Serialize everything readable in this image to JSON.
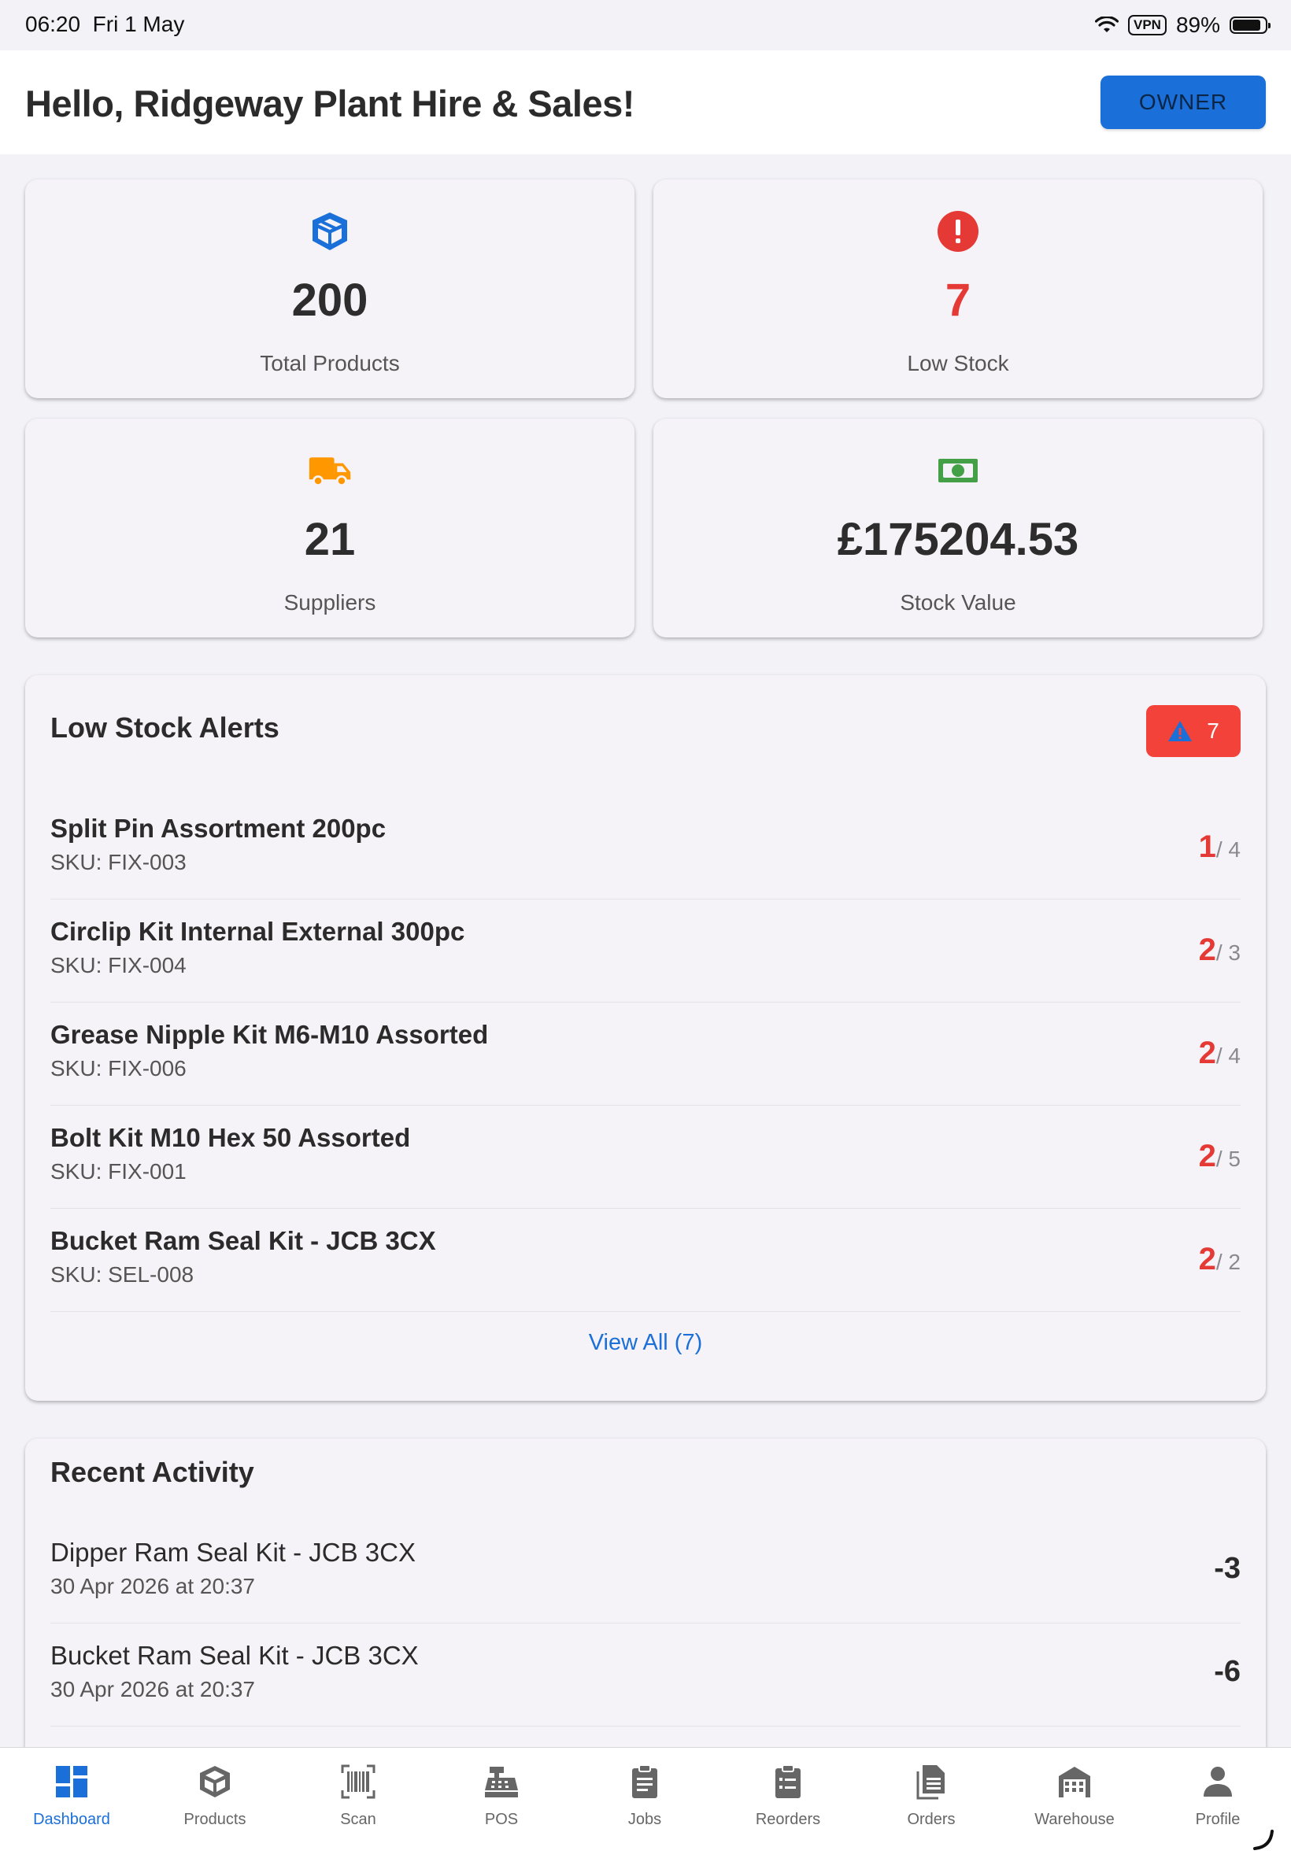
{
  "status_bar": {
    "time": "06:20",
    "date": "Fri 1 May",
    "vpn": "VPN",
    "battery": "89%",
    "battery_level": 0.89
  },
  "header": {
    "greeting": "Hello, Ridgeway Plant Hire & Sales!",
    "role": "OWNER"
  },
  "stats": [
    {
      "icon": "cube-icon",
      "value": "200",
      "label": "Total Products",
      "value_color": "#2d2d2d",
      "icon_color": "#1b6fd8"
    },
    {
      "icon": "alert-circle-icon",
      "value": "7",
      "label": "Low Stock",
      "value_color": "#e53935",
      "icon_color": "#e53935"
    },
    {
      "icon": "truck-icon",
      "value": "21",
      "label": "Suppliers",
      "value_color": "#2d2d2d",
      "icon_color": "#ff9800"
    },
    {
      "icon": "cash-icon",
      "value": "£175204.53",
      "label": "Stock Value",
      "value_color": "#2d2d2d",
      "icon_color": "#43a047"
    }
  ],
  "low_stock": {
    "title": "Low Stock Alerts",
    "badge_count": "7",
    "items": [
      {
        "name": "Split Pin Assortment 200pc",
        "sku": "SKU: FIX-003",
        "current": "1",
        "min": "/ 4"
      },
      {
        "name": "Circlip Kit Internal External 300pc",
        "sku": "SKU: FIX-004",
        "current": "2",
        "min": "/ 3"
      },
      {
        "name": "Grease Nipple Kit M6-M10 Assorted",
        "sku": "SKU: FIX-006",
        "current": "2",
        "min": "/ 4"
      },
      {
        "name": "Bolt Kit M10 Hex 50 Assorted",
        "sku": "SKU: FIX-001",
        "current": "2",
        "min": "/ 5"
      },
      {
        "name": "Bucket Ram Seal Kit - JCB 3CX",
        "sku": "SKU: SEL-008",
        "current": "2",
        "min": "/ 2"
      }
    ],
    "view_all": "View All (7)"
  },
  "recent_activity": {
    "title": "Recent Activity",
    "items": [
      {
        "name": "Dipper Ram Seal Kit - JCB 3CX",
        "date": "30 Apr 2026 at 20:37",
        "delta": "-3"
      },
      {
        "name": "Bucket Ram Seal Kit - JCB 3CX",
        "date": "30 Apr 2026 at 20:37",
        "delta": "-6"
      }
    ]
  },
  "tabs": [
    {
      "label": "Dashboard",
      "icon": "dashboard-icon",
      "active": true
    },
    {
      "label": "Products",
      "icon": "cube-icon",
      "active": false
    },
    {
      "label": "Scan",
      "icon": "barcode-icon",
      "active": false
    },
    {
      "label": "POS",
      "icon": "cash-register-icon",
      "active": false
    },
    {
      "label": "Jobs",
      "icon": "clipboard-icon",
      "active": false
    },
    {
      "label": "Reorders",
      "icon": "clipboard-list-icon",
      "active": false
    },
    {
      "label": "Orders",
      "icon": "documents-icon",
      "active": false
    },
    {
      "label": "Warehouse",
      "icon": "warehouse-icon",
      "active": false
    },
    {
      "label": "Profile",
      "icon": "person-icon",
      "active": false
    }
  ],
  "colors": {
    "accent": "#1b6fd8",
    "danger": "#e53935",
    "background": "#f2f2f7"
  }
}
